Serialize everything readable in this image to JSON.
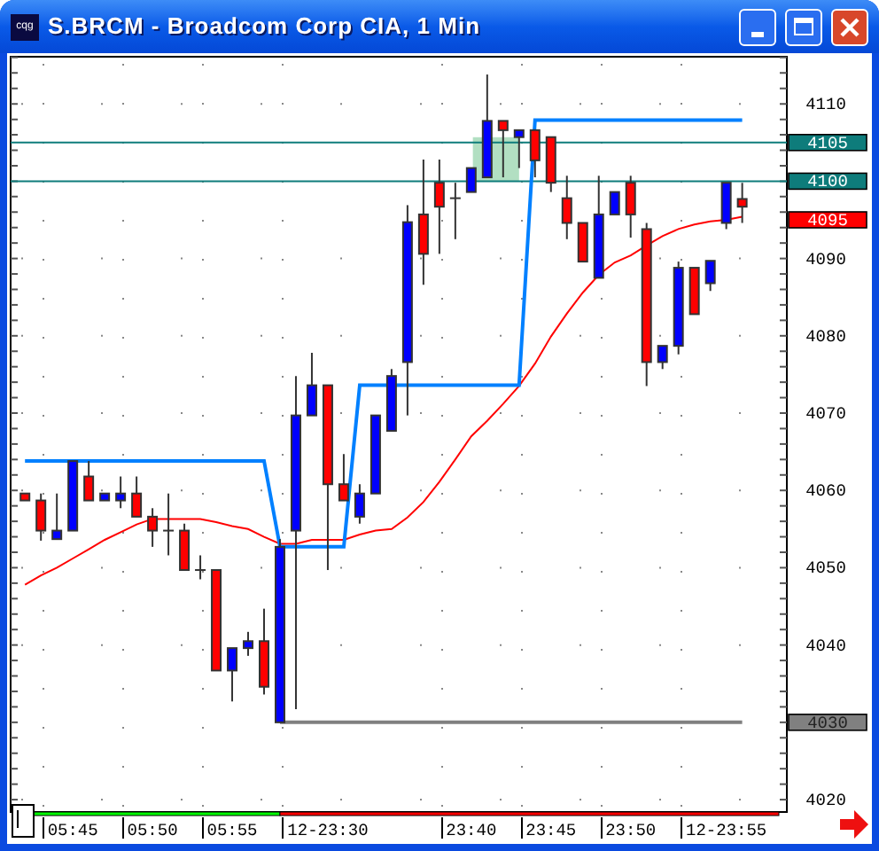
{
  "window": {
    "icon_text": "cqg",
    "title": "S.BRCM - Broadcom Corp CIA, 1 Min"
  },
  "chart": {
    "chart_data": {
      "type": "candlestick",
      "ylim": [
        4018.4,
        4116.1
      ],
      "grid": true,
      "categories": [
        null,
        null,
        null,
        "05:45",
        null,
        null,
        null,
        null,
        "05:50",
        null,
        null,
        null,
        null,
        "05:55",
        null,
        null,
        null,
        null,
        null,
        "12-23:30",
        null,
        null,
        null,
        null,
        null,
        null,
        null,
        null,
        "23:40",
        null,
        null,
        null,
        null,
        "23:45",
        null,
        null,
        null,
        null,
        "23:50",
        null,
        null,
        null,
        null,
        null,
        "12-23:55",
        null
      ],
      "yticks": [
        4020,
        4040,
        4050,
        4060,
        4070,
        4080,
        4090,
        4110
      ],
      "ohlc": [
        [
          4059.6,
          4059.6,
          4058.7,
          4058.7
        ],
        [
          4058.7,
          4059.6,
          4053.5,
          4054.8
        ],
        [
          4053.7,
          4059.6,
          4053.7,
          4054.8
        ],
        [
          4054.8,
          4063.8,
          4054.8,
          4063.8
        ],
        [
          4061.8,
          4063.8,
          4058.7,
          4058.7
        ],
        [
          4058.7,
          4059.6,
          4058.7,
          4059.6
        ],
        [
          4058.7,
          4061.8,
          4057.7,
          4059.6
        ],
        [
          4059.6,
          4061.8,
          4056.6,
          4056.6
        ],
        [
          4056.6,
          4057.7,
          4052.7,
          4054.8
        ],
        [
          4054.8,
          4059.6,
          4051.6,
          4054.8
        ],
        [
          4054.8,
          4055.7,
          4049.7,
          4049.7
        ],
        [
          4049.7,
          4051.6,
          4048.5,
          4049.7
        ],
        [
          4049.7,
          4049.7,
          4036.7,
          4036.7
        ],
        [
          4036.7,
          4039.6,
          4032.7,
          4039.6
        ],
        [
          4039.6,
          4041.7,
          4038.6,
          4040.5
        ],
        [
          4040.5,
          4044.7,
          4033.6,
          4034.6
        ],
        [
          4030,
          4053.7,
          4030,
          4052.7
        ],
        [
          4054.8,
          4074.8,
          4031.7,
          4069.7
        ],
        [
          4069.7,
          4077.8,
          4069.7,
          4073.6
        ],
        [
          4073.6,
          4073.6,
          4049.7,
          4060.8
        ],
        [
          4060.8,
          4064.7,
          4058.7,
          4058.7
        ],
        [
          4056.6,
          4060.8,
          4055.7,
          4059.6
        ],
        [
          4059.6,
          4069.7,
          4059.6,
          4069.7
        ],
        [
          4067.7,
          4075.7,
          4067.7,
          4074.8
        ],
        [
          4076.6,
          4096.9,
          4069.7,
          4094.7
        ],
        [
          4095.7,
          4102.8,
          4086.6,
          4090.6
        ],
        [
          4099.8,
          4102.8,
          4090.6,
          4096.7
        ],
        [
          4097.8,
          4099.8,
          4092.5,
          4097.8
        ],
        [
          4098.6,
          4101.7,
          4098.6,
          4101.7
        ],
        [
          4100.5,
          4113.8,
          4100.5,
          4107.8
        ],
        [
          4107.8,
          4107.8,
          4100.5,
          4106.6
        ],
        [
          4105.7,
          4106.6,
          4101.7,
          4106.6
        ],
        [
          4106.6,
          4106.6,
          4100.5,
          4102.7
        ],
        [
          4105.7,
          4105.7,
          4098.6,
          4099.8
        ],
        [
          4097.8,
          4100.7,
          4092.5,
          4094.6
        ],
        [
          4094.6,
          4094.6,
          4089.6,
          4089.6
        ],
        [
          4087.5,
          4100.7,
          4087.5,
          4095.7
        ],
        [
          4095.7,
          4098.6,
          4095.7,
          4098.6
        ],
        [
          4099.8,
          4100.7,
          4092.7,
          4095.7
        ],
        [
          4093.8,
          4094.6,
          4073.5,
          4076.6
        ],
        [
          4076.6,
          4078.7,
          4075.7,
          4078.7
        ],
        [
          4078.7,
          4089.6,
          4077.6,
          4088.8
        ],
        [
          4088.8,
          4088.8,
          4082.8,
          4082.8
        ],
        [
          4086.8,
          4089.7,
          4085.8,
          4089.7
        ],
        [
          4094.6,
          4099.8,
          4093.8,
          4099.8
        ],
        [
          4097.7,
          4099.8,
          4094.6,
          4096.7
        ]
      ],
      "series": [
        {
          "type": "line",
          "color": "#ff0000",
          "values": [
            4047.8,
            4049,
            4050,
            4051.2,
            4052.4,
            4053.6,
            4054.6,
            4055.6,
            4056.3,
            4056.3,
            4056.3,
            4056.3,
            4055.9,
            4055.4,
            4055,
            4054,
            4053.1,
            4053.1,
            4053.6,
            4053.6,
            4053.6,
            4054.3,
            4054.8,
            4055,
            4056.5,
            4058.5,
            4061.1,
            4064,
            4067,
            4069,
            4071.2,
            4073.5,
            4076.4,
            4079.9,
            4082.9,
            4085.6,
            4087.9,
            4089.5,
            4090.4,
            4091.7,
            4092.9,
            4093.8,
            4094.4,
            4094.8,
            4095,
            4095.4
          ]
        },
        {
          "type": "line",
          "color": "#0080ff",
          "values": [
            4063.8,
            4063.8,
            4063.8,
            4063.8,
            4063.8,
            4063.8,
            4063.8,
            4063.8,
            4063.8,
            4063.8,
            4063.8,
            4063.8,
            4063.8,
            4063.8,
            4063.8,
            4063.8,
            4052.7,
            4052.7,
            4052.7,
            4052.7,
            4052.7,
            4073.6,
            4073.6,
            4073.6,
            4073.6,
            4073.6,
            4073.6,
            4073.6,
            4073.6,
            4073.6,
            4073.6,
            4073.6,
            4107.9,
            4107.9,
            4107.9,
            4107.9,
            4107.9,
            4107.9,
            4107.9,
            4107.9,
            4107.9,
            4107.9,
            4107.9,
            4107.9,
            4107.9,
            4107.9
          ]
        },
        {
          "type": "line",
          "color": "#808080",
          "values": [
            null,
            null,
            null,
            null,
            null,
            null,
            null,
            null,
            null,
            null,
            null,
            null,
            null,
            null,
            null,
            null,
            4030,
            4030,
            4030,
            4030,
            4030,
            4030,
            4030,
            4030,
            4030,
            4030,
            4030,
            4030,
            4030,
            4030,
            4030,
            4030,
            4030,
            4030,
            4030,
            4030,
            4030,
            4030,
            4030,
            4030,
            4030,
            4030,
            4030,
            4030,
            4030,
            4030
          ]
        }
      ],
      "ref_lines": [
        {
          "axis": "y",
          "value": 4105,
          "label": "4105",
          "color": "#0e7c7b"
        },
        {
          "axis": "y",
          "value": 4100,
          "label": "4100",
          "color": "#0e7c7b"
        }
      ]
    },
    "price_tags": [
      {
        "label": "4095",
        "color": "#ff0000"
      },
      {
        "label": "4030",
        "color": "#808080"
      }
    ],
    "session_bar": [
      {
        "color": "#00ff00"
      },
      {
        "color": "#ff0000"
      }
    ]
  }
}
